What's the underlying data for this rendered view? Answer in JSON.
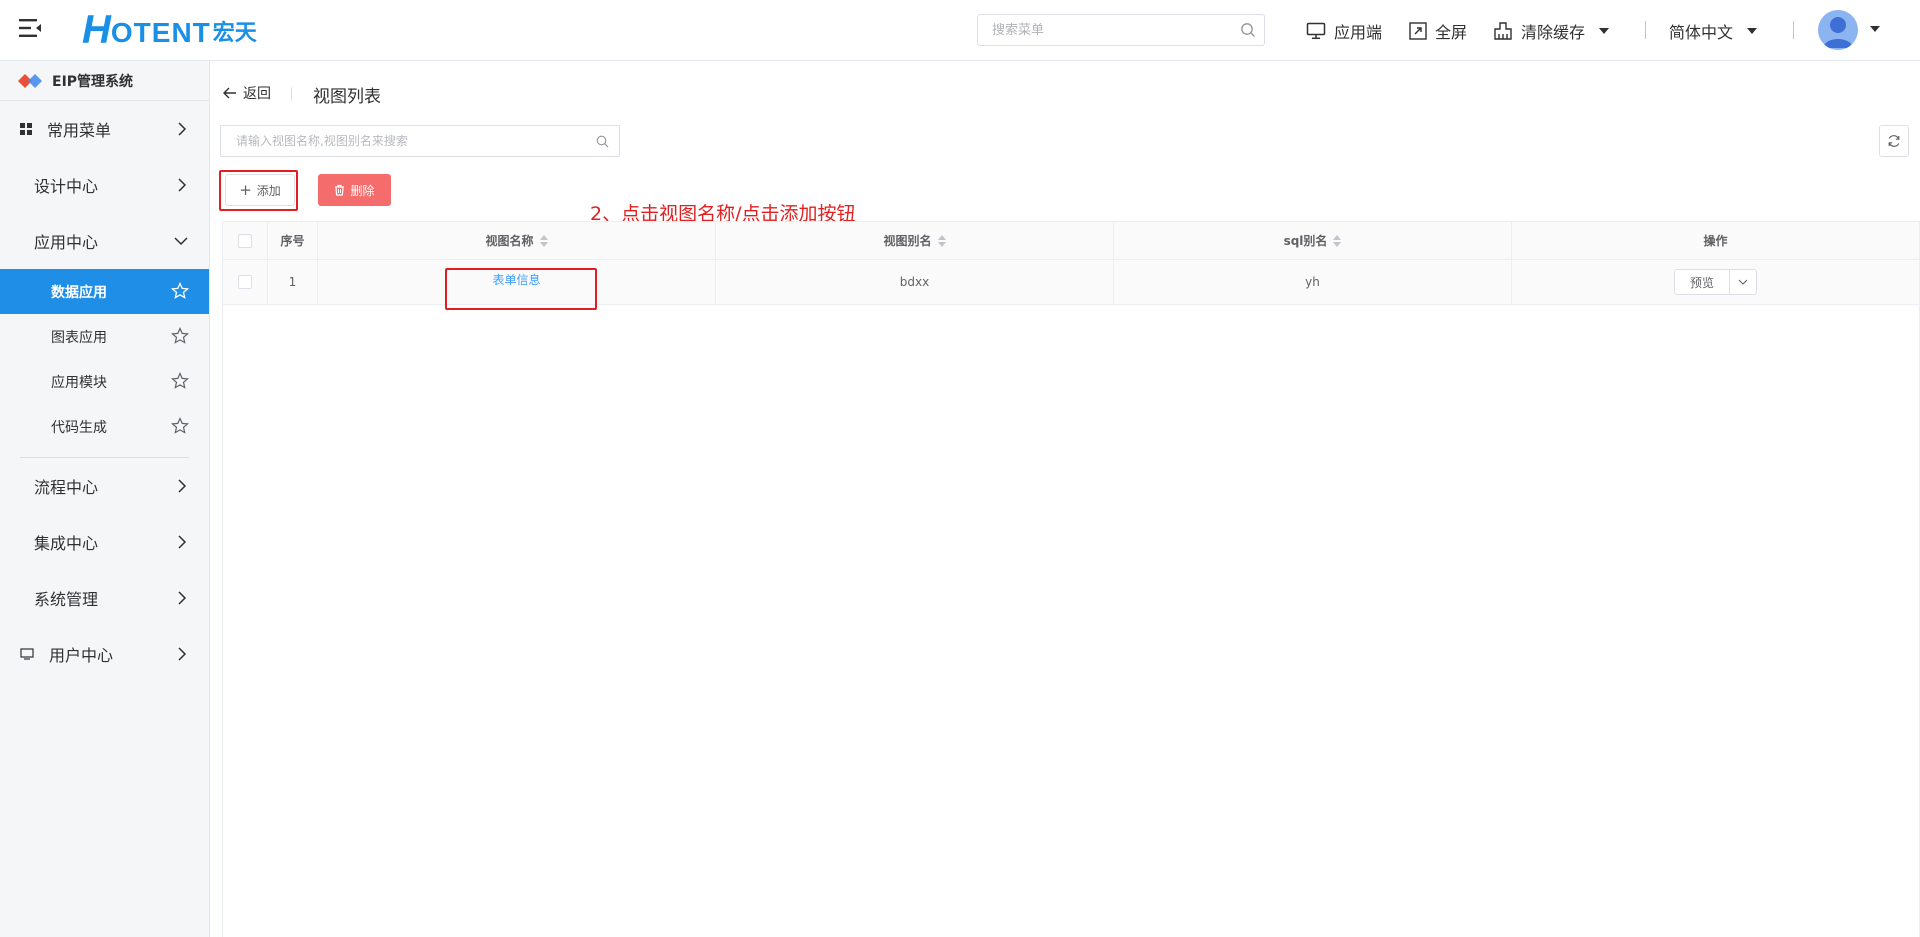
{
  "header": {
    "logo_h": "H",
    "logo_text": "OTENT",
    "logo_cn": "宏天",
    "search_placeholder": "搜索菜单",
    "app_end": "应用端",
    "fullscreen": "全屏",
    "clear_cache": "清除缓存",
    "language": "简体中文"
  },
  "sidebar": {
    "system_title": "EIP管理系统",
    "items": {
      "common": "常用菜单",
      "design": "设计中心",
      "app_center": "应用中心",
      "data_app": "数据应用",
      "chart_app": "图表应用",
      "app_module": "应用模块",
      "code_gen": "代码生成",
      "flow": "流程中心",
      "integration": "集成中心",
      "system": "系统管理",
      "user": "用户中心"
    }
  },
  "main": {
    "back": "返回",
    "page_title": "视图列表",
    "search_placeholder": "请输入视图名称,视图别名来搜索",
    "add_label": "添加",
    "delete_label": "删除",
    "annotation": "2、点击视图名称/点击添加按钮",
    "table": {
      "headers": {
        "idx": "序号",
        "name": "视图名称",
        "alias": "视图别名",
        "sql": "sql别名",
        "op": "操作"
      },
      "rows": [
        {
          "idx": "1",
          "name": "表单信息",
          "alias": "bdxx",
          "sql": "yh",
          "op": "预览"
        }
      ]
    }
  },
  "colors": {
    "primary": "#1e8ee6",
    "danger": "#f56c6c",
    "annotation": "#e02020",
    "link": "#409eff"
  }
}
